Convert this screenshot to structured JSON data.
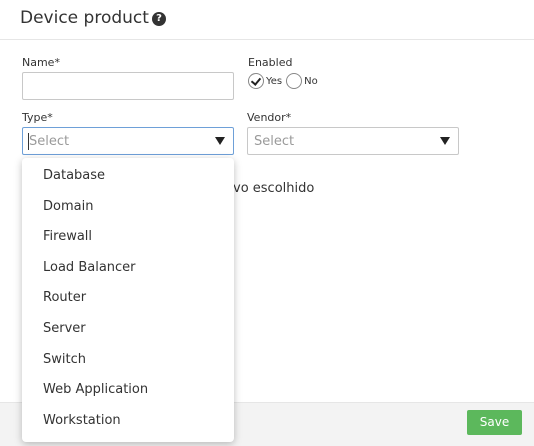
{
  "header": {
    "title": "Device product",
    "help_icon": "?"
  },
  "form": {
    "name_label": "Name*",
    "name_value": "",
    "enabled_label": "Enabled",
    "enabled_options": [
      {
        "label": "Yes",
        "checked": true
      },
      {
        "label": "No",
        "checked": false
      }
    ],
    "type_label": "Type*",
    "type_placeholder": "Select",
    "vendor_label": "Vendor*",
    "vendor_placeholder": "Select",
    "partial_text": "vo escolhido"
  },
  "dropdown": {
    "items": [
      "Database",
      "Domain",
      "Firewall",
      "Load Balancer",
      "Router",
      "Server",
      "Switch",
      "Web Application",
      "Workstation"
    ]
  },
  "footer": {
    "save_label": "Save"
  },
  "colors": {
    "save_button": "#5cb85c",
    "focus_border": "#6ea0d8"
  },
  "icons": {
    "help": "question-circle-icon",
    "dropdown_arrow": "triangle-down-icon",
    "radio_checked": "checkmark-icon"
  }
}
